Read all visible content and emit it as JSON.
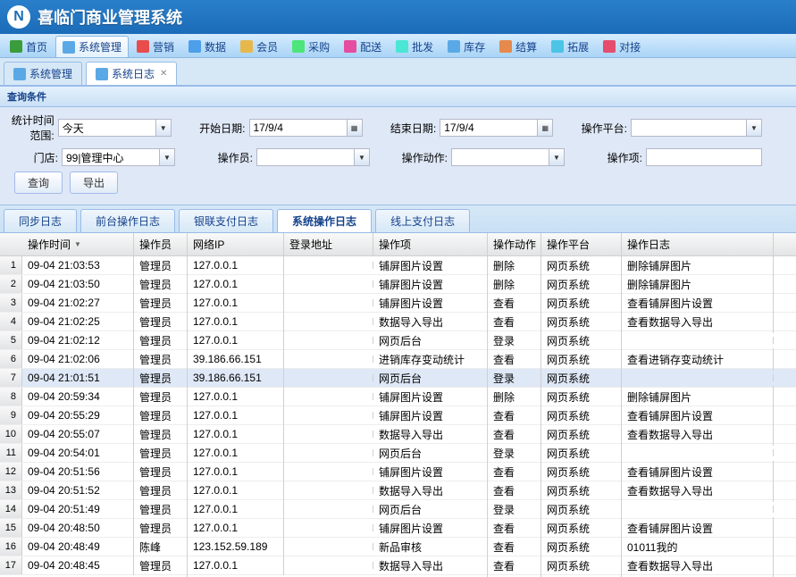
{
  "app": {
    "title": "喜临门商业管理系统",
    "logo": "N"
  },
  "menu": [
    {
      "label": "首页",
      "color": "#3b9c3b"
    },
    {
      "label": "系统管理",
      "color": "#5aa9e6",
      "active": true
    },
    {
      "label": "营销",
      "color": "#e84c4c"
    },
    {
      "label": "数据",
      "color": "#4c9fe8"
    },
    {
      "label": "会员",
      "color": "#e6b84c"
    },
    {
      "label": "采购",
      "color": "#4ce67a"
    },
    {
      "label": "配送",
      "color": "#e64c9f"
    },
    {
      "label": "批发",
      "color": "#4ce6d4"
    },
    {
      "label": "库存",
      "color": "#5aa9e6"
    },
    {
      "label": "结算",
      "color": "#e6894c"
    },
    {
      "label": "拓展",
      "color": "#4cc4e6"
    },
    {
      "label": "对接",
      "color": "#e64c6e"
    }
  ],
  "tabs": [
    {
      "label": "系统管理"
    },
    {
      "label": "系统日志",
      "active": true,
      "closable": true
    }
  ],
  "panel": {
    "title": "查询条件"
  },
  "filters": {
    "row1": {
      "range_label": "统计时间范围:",
      "range_value": "今天",
      "start_label": "开始日期:",
      "start_value": "17/9/4",
      "end_label": "结束日期:",
      "end_value": "17/9/4",
      "platform_label": "操作平台:",
      "platform_value": ""
    },
    "row2": {
      "store_label": "门店:",
      "store_value": "99|管理中心",
      "operator_label": "操作员:",
      "operator_value": "",
      "action_label": "操作动作:",
      "action_value": "",
      "item_label": "操作项:",
      "item_value": ""
    }
  },
  "buttons": {
    "query": "查询",
    "export": "导出"
  },
  "sub_tabs": [
    {
      "label": "同步日志"
    },
    {
      "label": "前台操作日志"
    },
    {
      "label": "银联支付日志"
    },
    {
      "label": "系统操作日志",
      "active": true
    },
    {
      "label": "线上支付日志"
    }
  ],
  "grid": {
    "columns": [
      "操作时间",
      "操作员",
      "网络IP",
      "登录地址",
      "操作项",
      "操作动作",
      "操作平台",
      "操作日志"
    ],
    "sort_col": 0,
    "rows": [
      [
        "09-04 21:03:53",
        "管理员",
        "127.0.0.1",
        "",
        "铺屏图片设置",
        "删除",
        "网页系统",
        "删除铺屏图片"
      ],
      [
        "09-04 21:03:50",
        "管理员",
        "127.0.0.1",
        "",
        "铺屏图片设置",
        "删除",
        "网页系统",
        "删除铺屏图片"
      ],
      [
        "09-04 21:02:27",
        "管理员",
        "127.0.0.1",
        "",
        "铺屏图片设置",
        "查看",
        "网页系统",
        "查看铺屏图片设置"
      ],
      [
        "09-04 21:02:25",
        "管理员",
        "127.0.0.1",
        "",
        "数据导入导出",
        "查看",
        "网页系统",
        "查看数据导入导出"
      ],
      [
        "09-04 21:02:12",
        "管理员",
        "127.0.0.1",
        "",
        "网页后台",
        "登录",
        "网页系统",
        ""
      ],
      [
        "09-04 21:02:06",
        "管理员",
        "39.186.66.151",
        "",
        "进销库存变动统计",
        "查看",
        "网页系统",
        "查看进销存变动统计"
      ],
      [
        "09-04 21:01:51",
        "管理员",
        "39.186.66.151",
        "",
        "网页后台",
        "登录",
        "网页系统",
        ""
      ],
      [
        "09-04 20:59:34",
        "管理员",
        "127.0.0.1",
        "",
        "铺屏图片设置",
        "删除",
        "网页系统",
        "删除铺屏图片"
      ],
      [
        "09-04 20:55:29",
        "管理员",
        "127.0.0.1",
        "",
        "铺屏图片设置",
        "查看",
        "网页系统",
        "查看铺屏图片设置"
      ],
      [
        "09-04 20:55:07",
        "管理员",
        "127.0.0.1",
        "",
        "数据导入导出",
        "查看",
        "网页系统",
        "查看数据导入导出"
      ],
      [
        "09-04 20:54:01",
        "管理员",
        "127.0.0.1",
        "",
        "网页后台",
        "登录",
        "网页系统",
        ""
      ],
      [
        "09-04 20:51:56",
        "管理员",
        "127.0.0.1",
        "",
        "铺屏图片设置",
        "查看",
        "网页系统",
        "查看铺屏图片设置"
      ],
      [
        "09-04 20:51:52",
        "管理员",
        "127.0.0.1",
        "",
        "数据导入导出",
        "查看",
        "网页系统",
        "查看数据导入导出"
      ],
      [
        "09-04 20:51:49",
        "管理员",
        "127.0.0.1",
        "",
        "网页后台",
        "登录",
        "网页系统",
        ""
      ],
      [
        "09-04 20:48:50",
        "管理员",
        "127.0.0.1",
        "",
        "铺屏图片设置",
        "查看",
        "网页系统",
        "查看铺屏图片设置"
      ],
      [
        "09-04 20:48:49",
        "陈峰",
        "123.152.59.189",
        "",
        "新品审核",
        "查看",
        "网页系统",
        "01011我的"
      ],
      [
        "09-04 20:48:45",
        "管理员",
        "127.0.0.1",
        "",
        "数据导入导出",
        "查看",
        "网页系统",
        "查看数据导入导出"
      ]
    ]
  }
}
